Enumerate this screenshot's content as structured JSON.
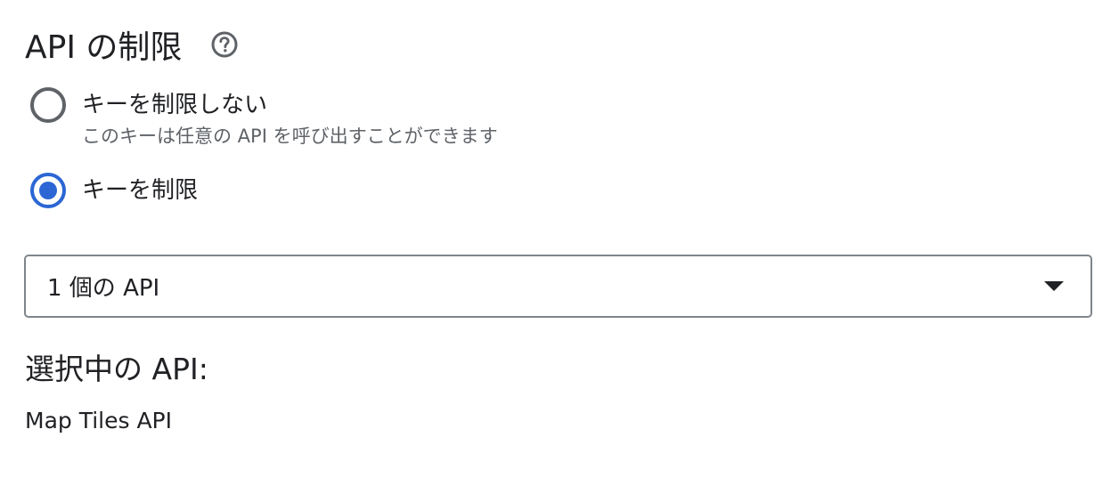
{
  "section": {
    "title": "API の制限",
    "help_icon": "help-circle-outline"
  },
  "restriction": {
    "options": [
      {
        "label": "キーを制限しない",
        "description": "このキーは任意の API を呼び出すことができます",
        "checked": false
      },
      {
        "label": "キーを制限",
        "checked": true
      }
    ]
  },
  "api_select": {
    "value": "1 個の API",
    "icon": "arrow-drop-down"
  },
  "selected_apis": {
    "heading": "選択中の API:",
    "items": [
      "Map Tiles API"
    ]
  },
  "colors": {
    "accent": "#2b66d4",
    "text_primary": "#202124",
    "text_secondary": "#5f6368",
    "border": "#80868b"
  }
}
